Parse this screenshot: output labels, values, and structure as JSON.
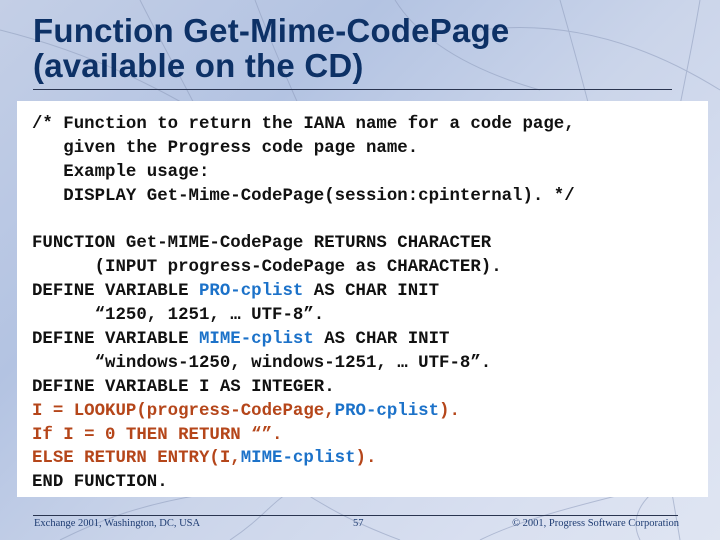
{
  "slide": {
    "title_line1": "Function Get-Mime-CodePage",
    "title_line2": "(available on the CD)",
    "code_lines": [
      [
        {
          "t": "/* Function to return the IANA name for a code page,",
          "c": "black"
        }
      ],
      [
        {
          "t": "   given the Progress code page name.",
          "c": "black"
        }
      ],
      [
        {
          "t": "   Example usage:",
          "c": "black"
        }
      ],
      [
        {
          "t": "   DISPLAY Get-Mime-CodePage(session:cpinternal). */",
          "c": "black"
        }
      ],
      [
        {
          "t": "",
          "c": "black"
        }
      ],
      [
        {
          "t": "FUNCTION Get-MIME-CodePage RETURNS CHARACTER",
          "c": "black"
        }
      ],
      [
        {
          "t": "      (INPUT progress-CodePage as CHARACTER).",
          "c": "black"
        }
      ],
      [
        {
          "t": "DEFINE VARIABLE ",
          "c": "black"
        },
        {
          "t": "PRO-cplist",
          "c": "blue"
        },
        {
          "t": " AS CHAR INIT",
          "c": "black"
        }
      ],
      [
        {
          "t": "      “1250, 1251, … UTF-8”.",
          "c": "black"
        }
      ],
      [
        {
          "t": "DEFINE VARIABLE ",
          "c": "black"
        },
        {
          "t": "MIME-cplist",
          "c": "blue"
        },
        {
          "t": " AS CHAR INIT",
          "c": "black"
        }
      ],
      [
        {
          "t": "      “windows-1250, windows-1251, … UTF-8”.",
          "c": "black"
        }
      ],
      [
        {
          "t": "DEFINE VARIABLE I AS INTEGER.",
          "c": "black"
        }
      ],
      [
        {
          "t": "I = LOOKUP(progress-CodePage,",
          "c": "red"
        },
        {
          "t": "PRO-cplist",
          "c": "blue"
        },
        {
          "t": ").",
          "c": "red"
        }
      ],
      [
        {
          "t": "If I = 0 THEN RETURN “”.",
          "c": "red"
        }
      ],
      [
        {
          "t": "ELSE RETURN ENTRY(I,",
          "c": "red"
        },
        {
          "t": "MIME-cplist",
          "c": "blue"
        },
        {
          "t": ").",
          "c": "red"
        }
      ],
      [
        {
          "t": "END FUNCTION.",
          "c": "black"
        }
      ]
    ]
  },
  "footer": {
    "left": "Exchange 2001, Washington, DC, USA",
    "page_number": "57",
    "right": "© 2001, Progress Software Corporation"
  },
  "colors": {
    "title": "#0d3166",
    "code_black": "#111111",
    "code_blue": "#1c72c9",
    "code_red": "#b5461a",
    "footer_text": "#1f3d73"
  }
}
